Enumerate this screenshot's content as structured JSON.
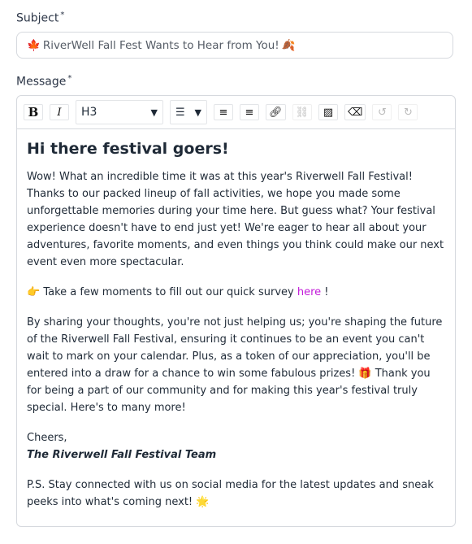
{
  "subject": {
    "label": "Subject",
    "required": "*",
    "value": "RiverWell Fall Fest Wants to Hear from You!",
    "emoji_start": "🍁",
    "emoji_end": "🍂"
  },
  "message": {
    "label": "Message",
    "required": "*"
  },
  "toolbar": {
    "bold": "B",
    "italic": "I",
    "heading": "H3",
    "caret": "▼"
  },
  "body": {
    "heading": "Hi there festival goers!",
    "p1": "Wow! What an incredible time it was at this year's Riverwell Fall Festival! Thanks to our packed lineup of fall activities, we hope you made some unforgettable memories during your time here. But guess what? Your festival experience doesn't have to end just yet! We're eager to hear all about your adventures, favorite moments, and even things you think could make our next event even more spectacular.",
    "p2_emoji": "👉",
    "p2_text": " Take a few moments to fill out our quick survey ",
    "p2_link": "here",
    "p2_end": " !",
    "p3": "By sharing your thoughts, you're not just helping us; you're shaping the future of the Riverwell Fall Festival, ensuring it continues to be an event you can't wait to mark on your calendar. Plus, as a token of our appreciation, you'll be entered into a draw for a chance to win some fabulous prizes! ",
    "p3_emoji": "🎁",
    "p3_end": " Thank you for being a part of our community and for making this year's festival truly special. Here's to many more!",
    "cheers": "Cheers,",
    "team": "The Riverwell Fall Festival Team",
    "ps": "P.S. Stay connected with us on social media for the latest updates and sneak peeks into what's coming next! ",
    "ps_emoji": "🌟"
  }
}
